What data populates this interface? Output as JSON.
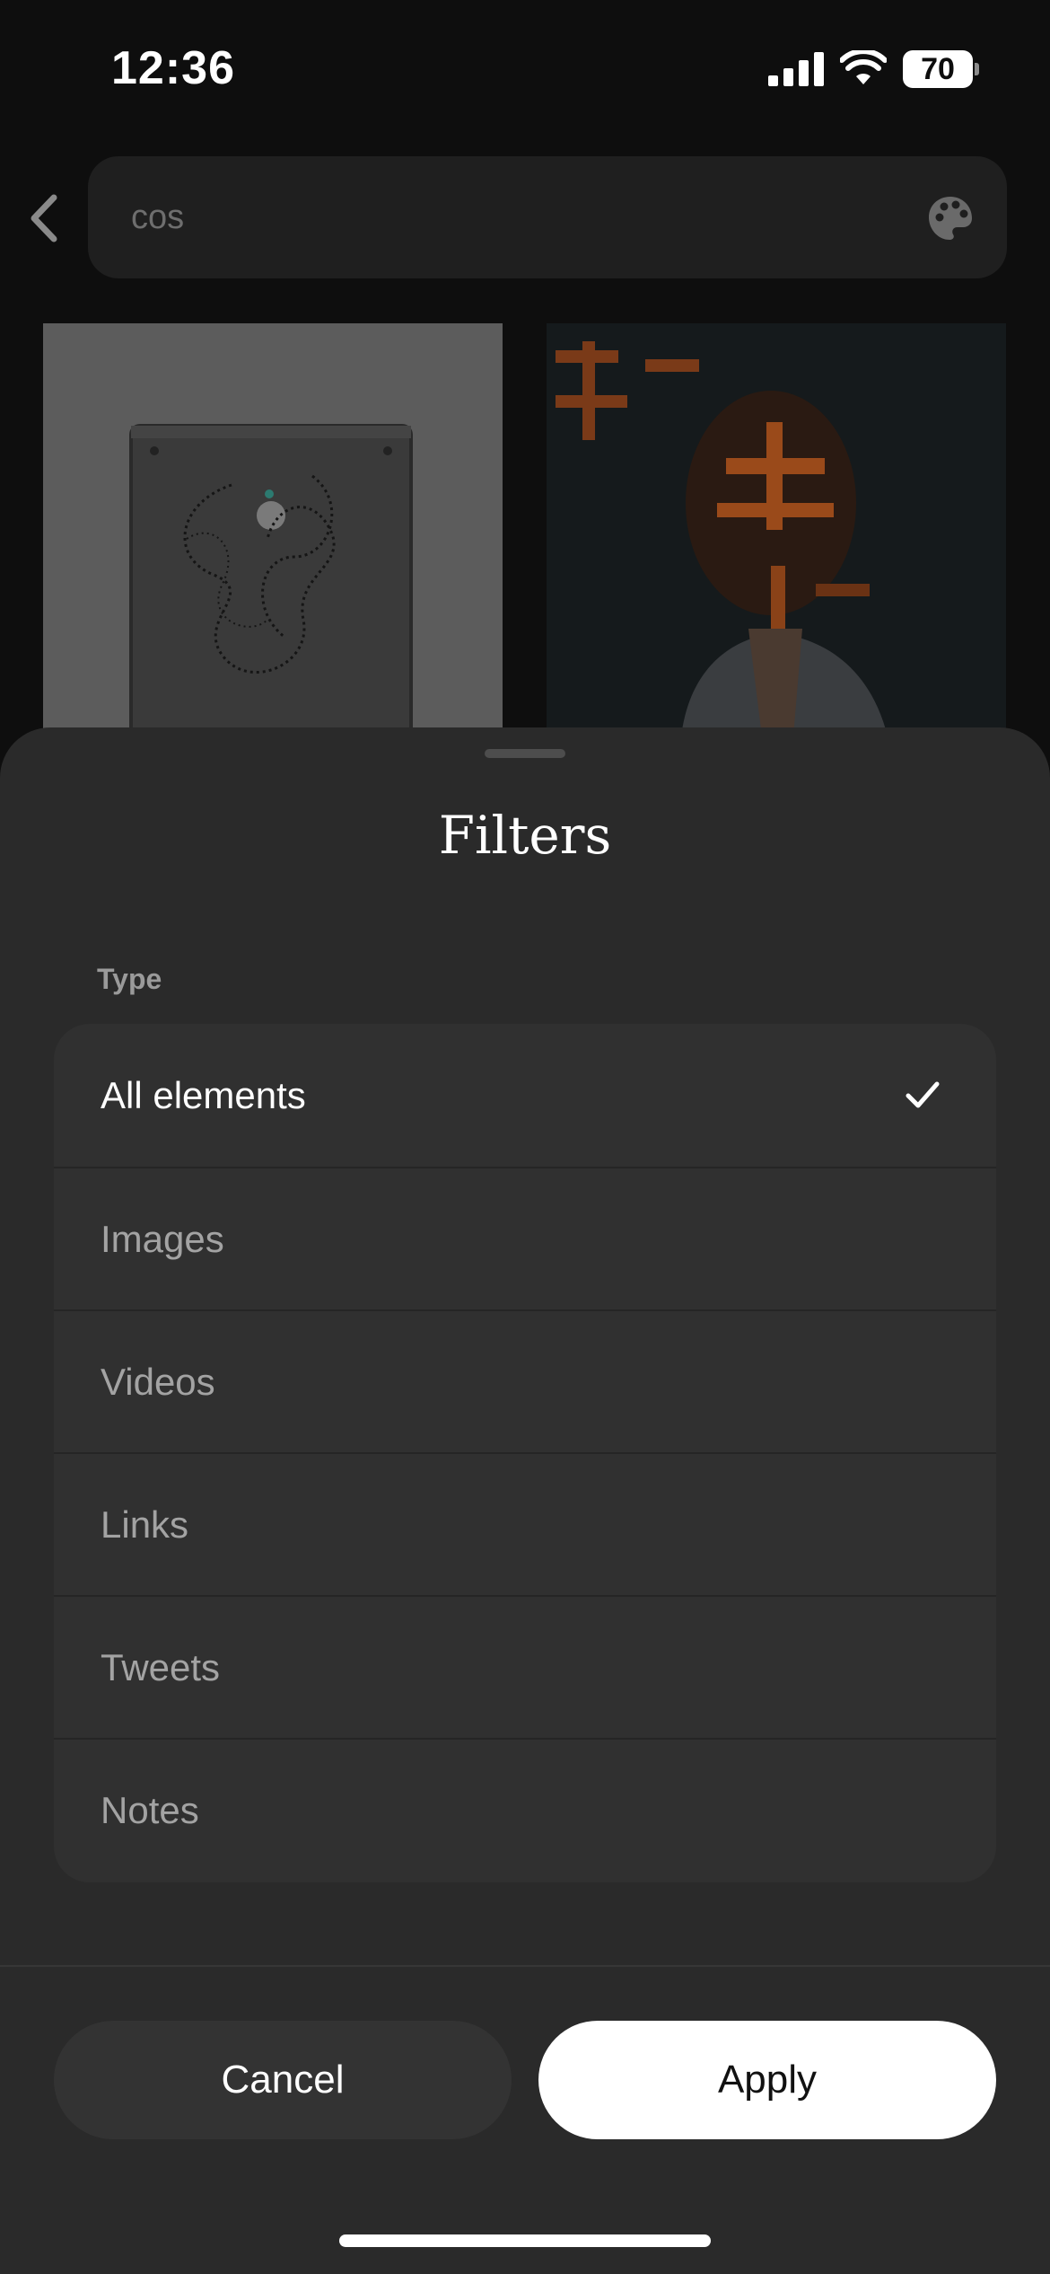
{
  "status_bar": {
    "time": "12:36",
    "battery": "70"
  },
  "search": {
    "query": "cos"
  },
  "filters": {
    "title": "Filters",
    "section_label": "Type",
    "options": [
      {
        "label": "All elements",
        "selected": true
      },
      {
        "label": "Images",
        "selected": false
      },
      {
        "label": "Videos",
        "selected": false
      },
      {
        "label": "Links",
        "selected": false
      },
      {
        "label": "Tweets",
        "selected": false
      },
      {
        "label": "Notes",
        "selected": false
      }
    ],
    "cancel_label": "Cancel",
    "apply_label": "Apply"
  },
  "icons": {
    "back": "chevron-left-icon",
    "palette": "palette-icon",
    "check": "checkmark-icon",
    "signal": "cellular-signal-icon",
    "wifi": "wifi-icon",
    "battery": "battery-icon"
  },
  "colors": {
    "background": "#0e0e0e",
    "sheet": "#2a2a2a",
    "options_panel": "#303030",
    "apply_button": "#ffffff",
    "cancel_button": "#333333"
  }
}
